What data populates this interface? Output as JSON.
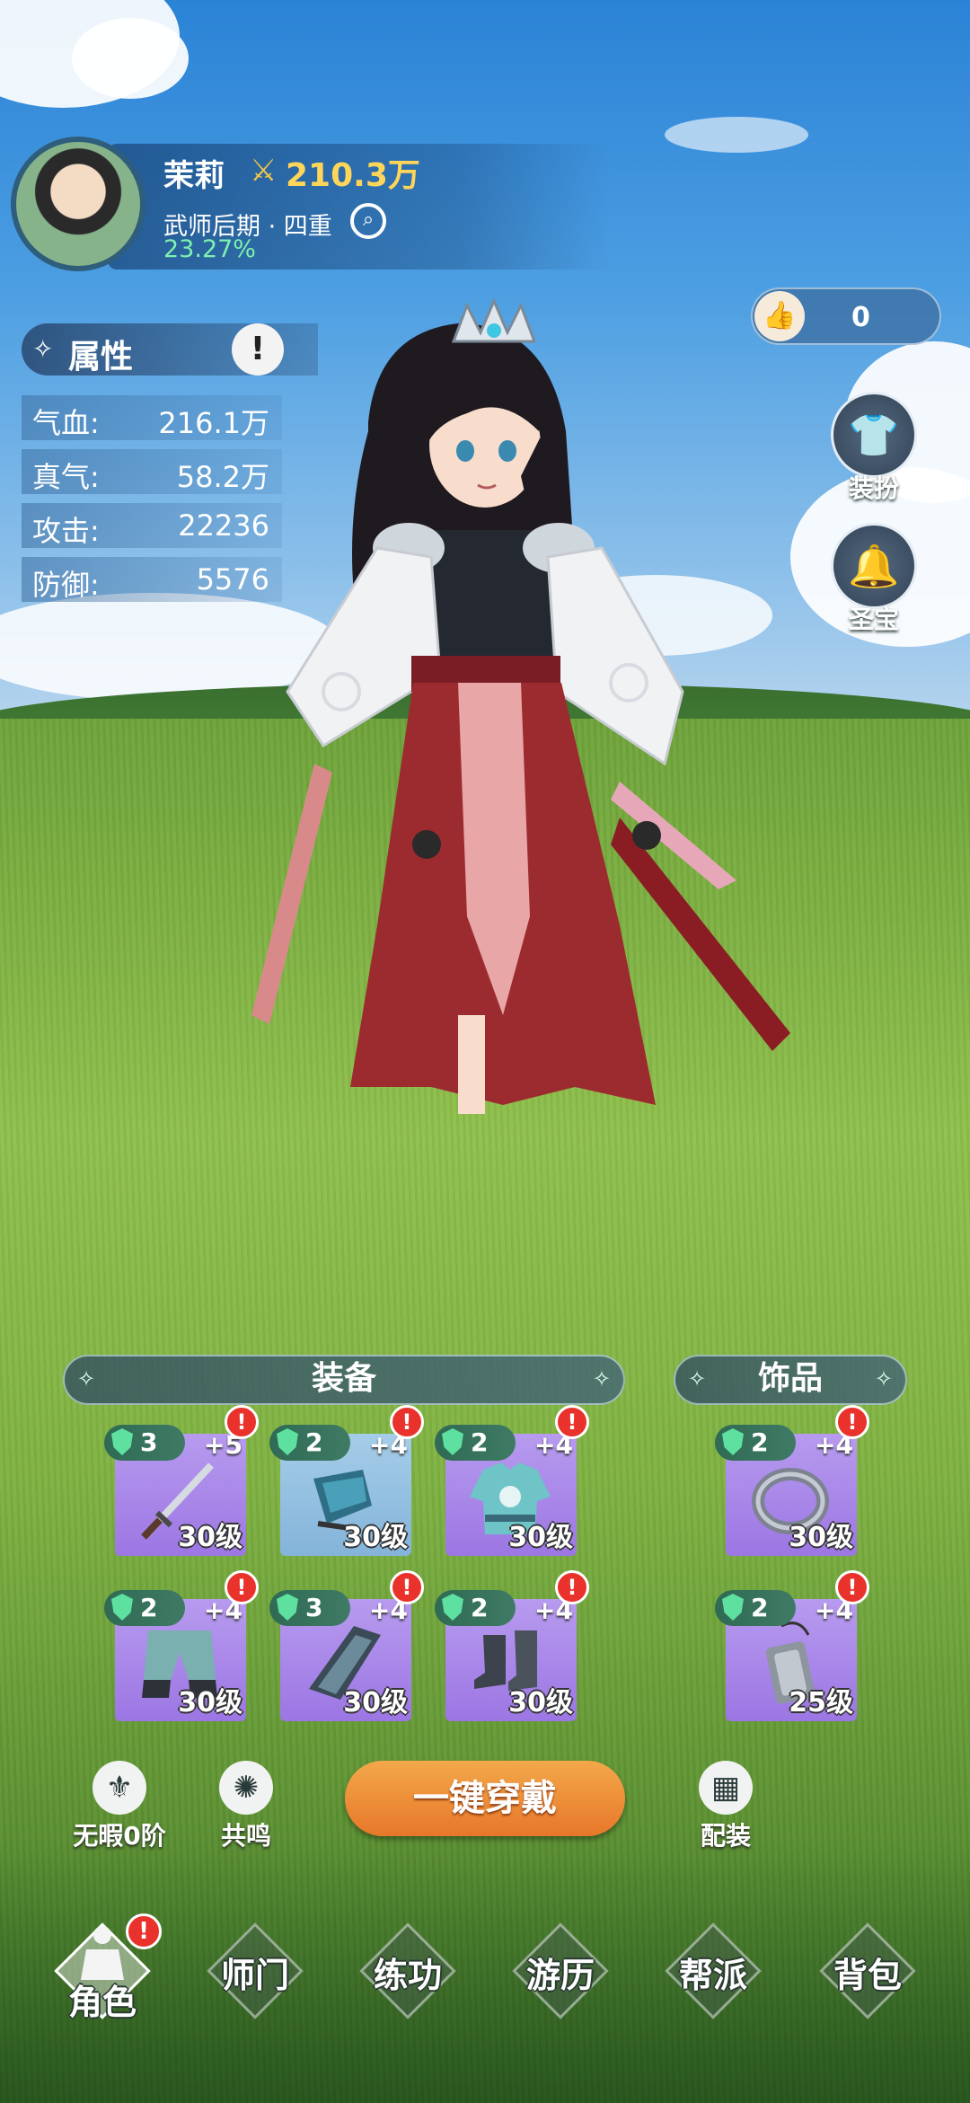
{
  "player": {
    "name": "茉莉",
    "power": "210.3万",
    "rank": "武师后期 · 四重",
    "progress": "23.27%"
  },
  "likes": {
    "count": "0"
  },
  "attributes": {
    "title": "属性",
    "info_icon": "!",
    "rows": [
      {
        "label": "气血:",
        "value": "216.1万"
      },
      {
        "label": "真气:",
        "value": "58.2万"
      },
      {
        "label": "攻击:",
        "value": "22236"
      },
      {
        "label": "防御:",
        "value": "5576"
      }
    ]
  },
  "side_buttons": [
    {
      "label": "装扮",
      "icon": "outfit-icon"
    },
    {
      "label": "圣宝",
      "icon": "bell-icon"
    }
  ],
  "equipment": {
    "title": "装备",
    "slots": [
      {
        "tier": "3",
        "plus": "+5",
        "level": "30级",
        "item": "sword"
      },
      {
        "tier": "2",
        "plus": "+4",
        "level": "30级",
        "item": "helmet"
      },
      {
        "tier": "2",
        "plus": "+4",
        "level": "30级",
        "item": "robe"
      },
      {
        "tier": "2",
        "plus": "+4",
        "level": "30级",
        "item": "trousers"
      },
      {
        "tier": "3",
        "plus": "+4",
        "level": "30级",
        "item": "bracer"
      },
      {
        "tier": "2",
        "plus": "+4",
        "level": "30级",
        "item": "boots"
      }
    ]
  },
  "accessories": {
    "title": "饰品",
    "slots": [
      {
        "tier": "2",
        "plus": "+4",
        "level": "30级",
        "item": "ring"
      },
      {
        "tier": "2",
        "plus": "+4",
        "level": "25级",
        "item": "pendant"
      }
    ]
  },
  "actions": {
    "flawless": "无暇0阶",
    "resonance": "共鸣",
    "wear_all": "一键穿戴",
    "loadout": "配装"
  },
  "nav": [
    {
      "label": "角色",
      "active": true,
      "badge": "!"
    },
    {
      "label": "师门"
    },
    {
      "label": "练功"
    },
    {
      "label": "游历"
    },
    {
      "label": "帮派"
    },
    {
      "label": "背包"
    }
  ],
  "colors": {
    "slot_purple": "#a985e8",
    "alert_red": "#e8322b",
    "wear_button": "#ee8a35",
    "power_gold": "#ffd55a",
    "progress_green": "#7ef0b0"
  }
}
